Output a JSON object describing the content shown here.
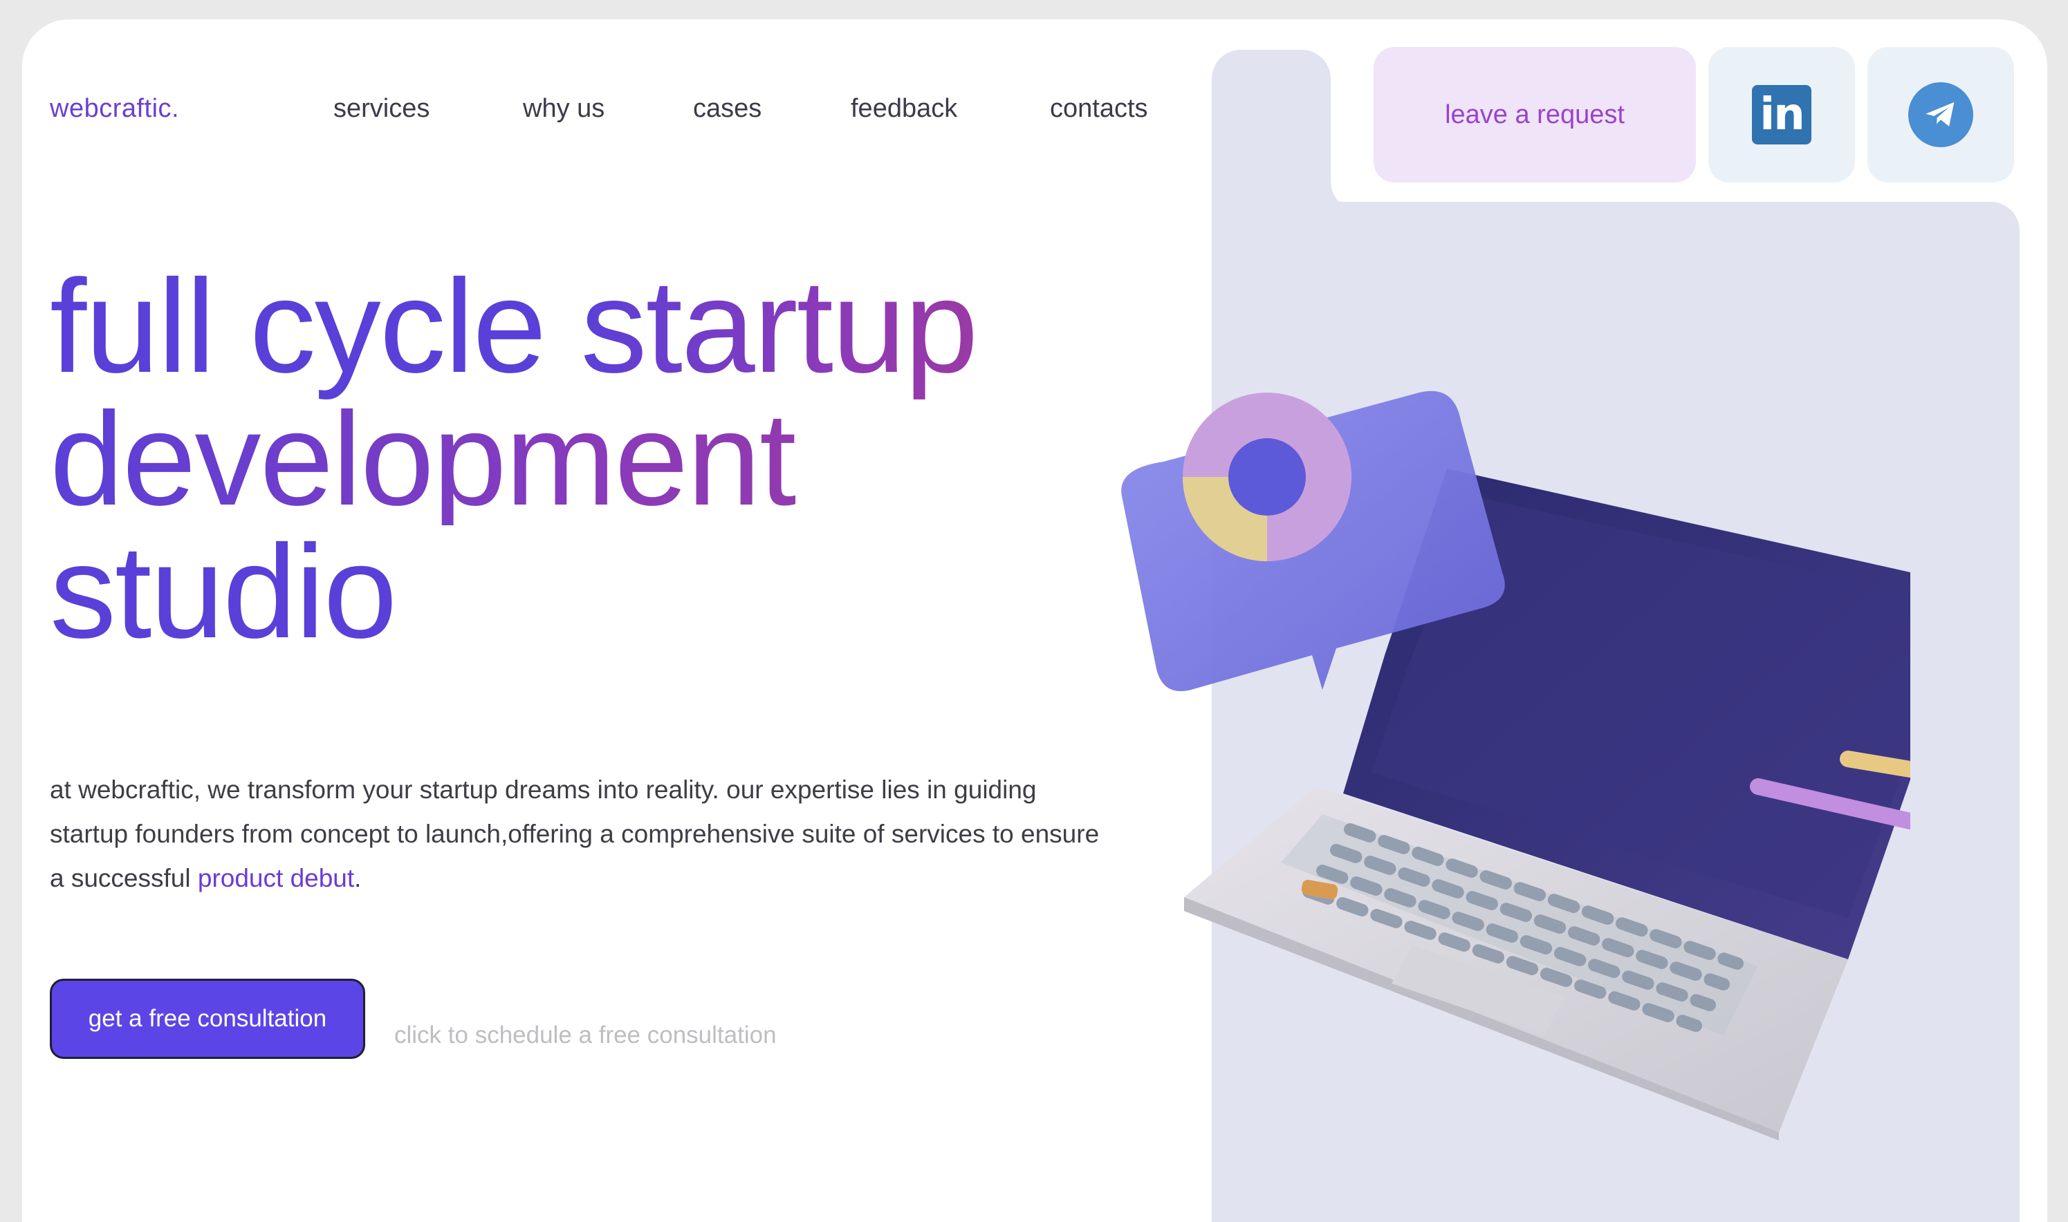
{
  "header": {
    "logo": "webcraftic.",
    "nav": [
      {
        "label": "services"
      },
      {
        "label": "why us"
      },
      {
        "label": "cases"
      },
      {
        "label": "feedback"
      },
      {
        "label": "contacts"
      }
    ],
    "request_label": "leave a request",
    "social": [
      {
        "name": "linkedin",
        "icon": "linkedin-icon"
      },
      {
        "name": "telegram",
        "icon": "telegram-icon"
      }
    ]
  },
  "hero": {
    "headline": {
      "line1_a": "full cycle",
      "line1_b": "startup",
      "line2": "development",
      "line3": "studio"
    },
    "description": {
      "text": "at webcraftic, we transform your startup dreams into reality. our expertise lies in guiding startup founders from concept to launch,offering a comprehensive suite of services to ensure a successful ",
      "highlight": "product debut",
      "end": "."
    },
    "cta_label": "get a free consultation",
    "cta_hint": "click to schedule a free consultation"
  },
  "colors": {
    "accent": "#5a40d8",
    "accent_purple": "#9a3aa4",
    "panel": "#e1e3f0",
    "request_bg": "#f0e4f8",
    "cta": "#5c45e6"
  }
}
